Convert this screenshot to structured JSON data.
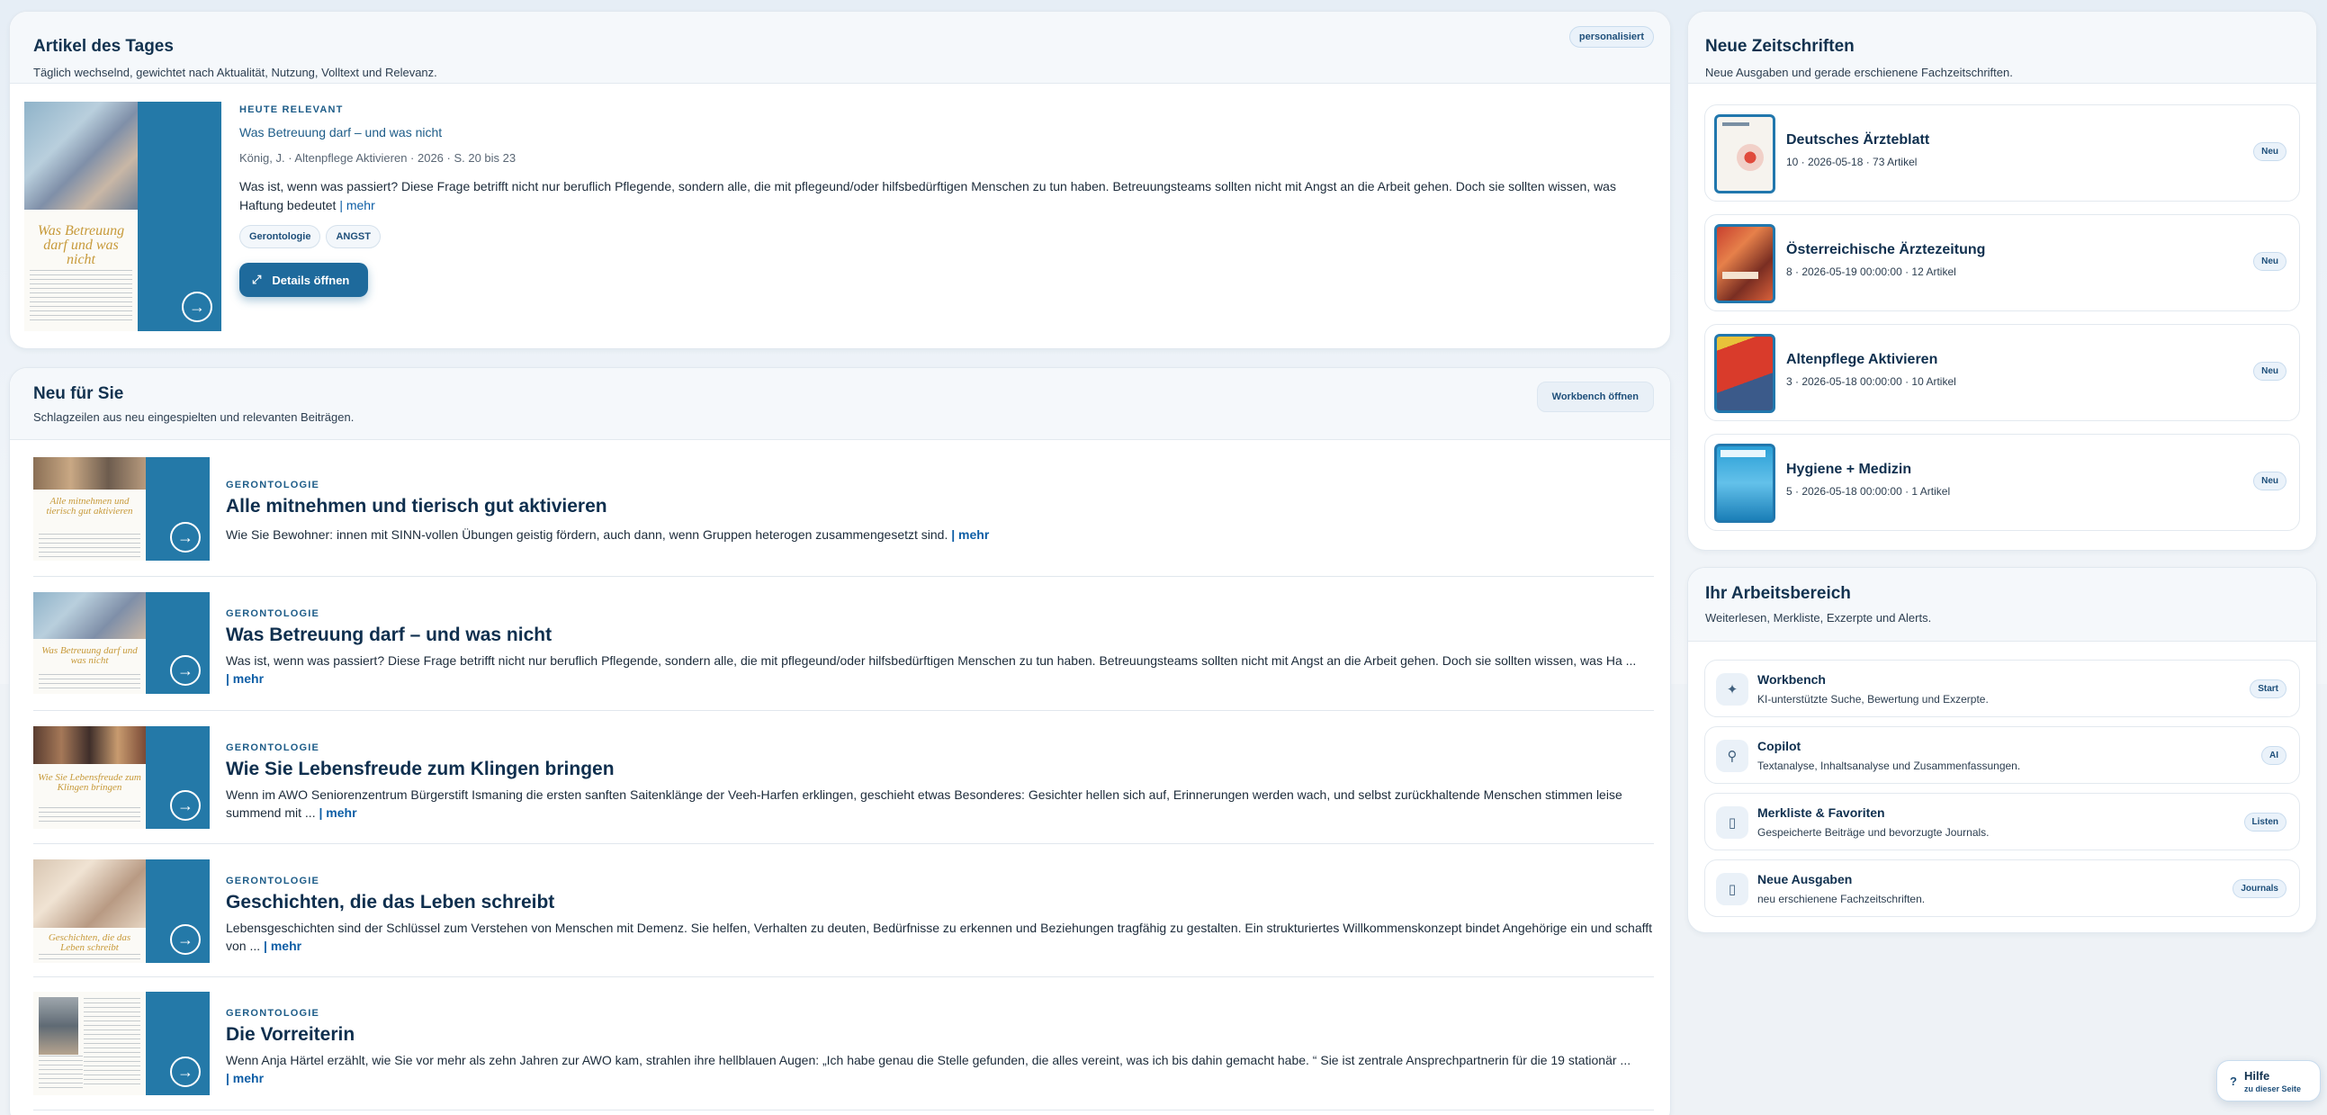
{
  "article_of_day": {
    "title": "Artikel des Tages",
    "subtitle": "Täglich wechselnd, gewichtet nach Aktualität, Nutzung, Volltext und Relevanz.",
    "badge": "personalisiert",
    "kicker": "HEUTE RELEVANT",
    "headline": "Was Betreuung darf – und was nicht",
    "meta": "König, J. · Altenpflege Aktivieren · 2026 · S. 20 bis 23",
    "text": "Was ist, wenn was passiert? Diese Frage betrifft nicht nur beruflich Pflegende, sondern alle, die mit pflegeund/oder hilfsbedürftigen Menschen zu tun haben. Betreuungsteams sollten nicht mit Angst an die Arbeit gehen. Doch sie sollten wissen, was Haftung bedeutet",
    "more": "| mehr",
    "tags": [
      "Gerontologie",
      "ANGST"
    ],
    "button": "Details öffnen",
    "thumb_title": "Was Betreuung darf und was nicht"
  },
  "new_for_you": {
    "title": "Neu für Sie",
    "subtitle": "Schlagzeilen aus neu eingespielten und relevanten Beiträgen.",
    "button": "Workbench öffnen",
    "items": [
      {
        "kicker": "GERONTOLOGIE",
        "title": "Alle mitnehmen und tierisch gut aktivieren",
        "text": "Wie Sie Bewohner: innen mit SINN-vollen Übungen geistig fördern, auch dann, wenn Gruppen heterogen zusammengesetzt sind.",
        "more": "| mehr",
        "thumb_title": "Alle mitnehmen und tierisch gut aktivieren"
      },
      {
        "kicker": "GERONTOLOGIE",
        "title": "Was Betreuung darf – und was nicht",
        "text": "Was ist, wenn was passiert? Diese Frage betrifft nicht nur beruflich Pflegende, sondern alle, die mit pflegeund/oder hilfsbedürftigen Menschen zu tun haben. Betreuungsteams sollten nicht mit Angst an die Arbeit gehen. Doch sie sollten wissen, was Ha ...",
        "more": "| mehr",
        "thumb_title": "Was Betreuung darf und was nicht"
      },
      {
        "kicker": "GERONTOLOGIE",
        "title": "Wie Sie Lebensfreude zum Klingen bringen",
        "text": "Wenn im AWO Seniorenzentrum Bürgerstift Ismaning die ersten sanften Saitenklänge der Veeh-Harfen erklingen, geschieht etwas Besonderes: Gesichter hellen sich auf, Erinnerungen werden wach, und selbst zurückhaltende Menschen stimmen leise summend mit ...",
        "more": "| mehr",
        "thumb_title": "Wie Sie Lebensfreude zum Klingen bringen"
      },
      {
        "kicker": "GERONTOLOGIE",
        "title": "Geschichten, die das Leben schreibt",
        "text": "Lebensgeschichten sind der Schlüssel zum Verstehen von Menschen mit Demenz. Sie helfen, Verhalten zu deuten, Bedürfnisse zu erkennen und Beziehungen tragfähig zu gestalten. Ein strukturiertes Willkommenskonzept bindet Angehörige ein und schafft von ...",
        "more": "| mehr",
        "thumb_title": "Geschichten, die das Leben schreibt"
      },
      {
        "kicker": "GERONTOLOGIE",
        "title": "Die Vorreiterin",
        "text": "Wenn Anja Härtel erzählt, wie Sie vor mehr als zehn Jahren zur AWO kam, strahlen ihre hellblauen Augen: „Ich habe genau die Stelle gefunden, die alles vereint, was ich bis dahin gemacht habe. “ Sie ist zentrale Ansprechpartnerin für die 19 stationär ...",
        "more": "| mehr",
        "thumb_title": ""
      }
    ]
  },
  "new_journals": {
    "title": "Neue Zeitschriften",
    "subtitle": "Neue Ausgaben und gerade erschienene Fachzeitschriften.",
    "items": [
      {
        "title": "Deutsches Ärzteblatt",
        "meta": "10 · 2026-05-18 · 73 Artikel",
        "badge": "Neu",
        "color": "#f6f3ee"
      },
      {
        "title": "Österreichische Ärztezeitung",
        "meta": "8 · 2026-05-19 00:00:00 · 12 Artikel",
        "badge": "Neu",
        "color": "#c8402f"
      },
      {
        "title": "Altenpflege Aktivieren",
        "meta": "3 · 2026-05-18 00:00:00 · 10 Artikel",
        "badge": "Neu",
        "color": "#d93b2b"
      },
      {
        "title": "Hygiene + Medizin",
        "meta": "5 · 2026-05-18 00:00:00 · 1 Artikel",
        "badge": "Neu",
        "color": "#2a9fd6"
      }
    ]
  },
  "workspace": {
    "title": "Ihr Arbeitsbereich",
    "subtitle": "Weiterlesen, Merkliste, Exzerpte und Alerts.",
    "items": [
      {
        "title": "Workbench",
        "desc": "KI-unterstützte Suche, Bewertung und Exzerpte.",
        "badge": "Start",
        "icon": "✦"
      },
      {
        "title": "Copilot",
        "desc": "Textanalyse, Inhaltsanalyse und Zusammenfassungen.",
        "badge": "AI",
        "icon": "⚲"
      },
      {
        "title": "Merkliste & Favoriten",
        "desc": "Gespeicherte Beiträge und bevorzugte Journals.",
        "badge": "Listen",
        "icon": "▯"
      },
      {
        "title": "Neue Ausgaben",
        "desc": "neu erschienene Fachzeitschriften.",
        "badge": "Journals",
        "icon": "▯"
      }
    ]
  },
  "help": {
    "label": "Hilfe",
    "sub": "zu dieser Seite",
    "icon": "?"
  }
}
